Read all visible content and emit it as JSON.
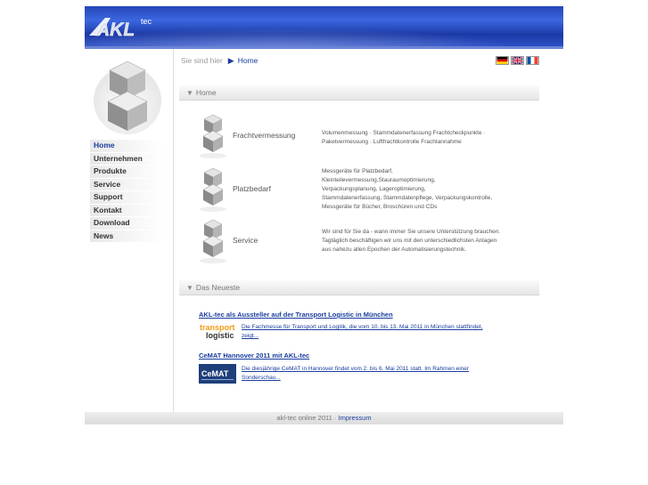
{
  "header": {
    "logo_text": "AKL",
    "logo_suffix": "tec"
  },
  "nav": {
    "items": [
      {
        "label": "Home",
        "active": true
      },
      {
        "label": "Unternehmen"
      },
      {
        "label": "Produkte"
      },
      {
        "label": "Service"
      },
      {
        "label": "Support"
      },
      {
        "label": "Kontakt"
      },
      {
        "label": "Download"
      },
      {
        "label": "News"
      }
    ]
  },
  "breadcrumb": {
    "prefix": "Sie sind hier",
    "current": "Home"
  },
  "flags": [
    "de",
    "uk",
    "fr"
  ],
  "sections": {
    "home": "Home",
    "news": "Das Neueste"
  },
  "categories": [
    {
      "label": "Frachtvermessung",
      "desc_lines": [
        "Volumenmessung · Stammdatenerfassung Frachtcheckpunkte ·",
        "Paketvermessung · Luftfrachtkontrolle Frachtannahme"
      ]
    },
    {
      "label": "Platzbedarf",
      "desc_lines": [
        "Messgeräte für Platzbedarf,",
        "Kleinteilevermessung,Stauraumoptimierung,",
        "Verpackungsplanung, Lageroptimierung,",
        "Stammdatenerfassung, Stammdatenpflege, Verpackungskontrolle,",
        "Messgeräte für Bücher, Broschüren und CDs"
      ]
    },
    {
      "label": "Service",
      "desc_lines": [
        "Wir sind für Sie da - wann immer Sie unsere Unterstützung brauchen.",
        "Tagtäglich beschäftigen wir uns mit den unterschiedlichsten Anlagen",
        "aus nahezu allen Epochen der Automatisierungstechnik."
      ]
    }
  ],
  "news": [
    {
      "title": "AKL-tec als Aussteller auf der Transport Logistic in München",
      "logo_top": "transport",
      "logo_bottom": "logistic",
      "text_lines": [
        "Die Fachmesse für Transport und Logitik, die vom 10. bis 13. Mai 2011 in München stattfindet,",
        "zeigt..."
      ]
    },
    {
      "title": "CeMAT Hannover 2011 mit AKL-tec",
      "logo_text": "CeMAT",
      "text_lines": [
        "Die diesjährige CeMAT in Hannover findet vom 2. bis 6. Mai 2011 statt. Im Rahmen einer",
        "Sonderschau..."
      ]
    }
  ],
  "footer": {
    "text": "akl-tec online 2011 · ",
    "link": "Impressum"
  },
  "colors": {
    "brand_blue": "#1a3d9e",
    "header_blue": "#2c4fc6"
  }
}
